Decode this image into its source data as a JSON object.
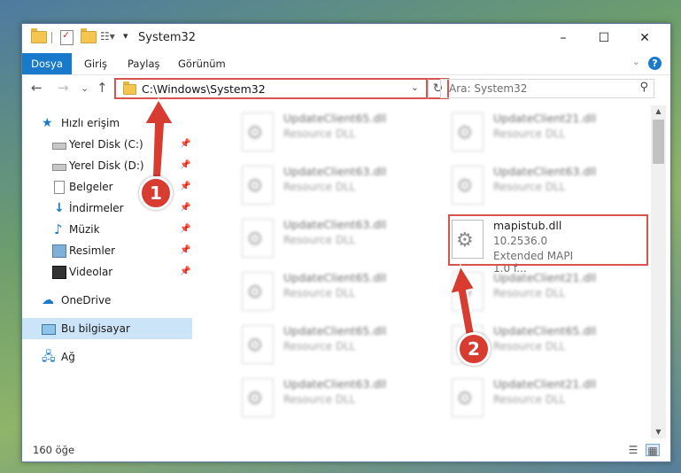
{
  "window": {
    "title": "System32",
    "controls": {
      "minimize": "–",
      "maximize": "☐",
      "close": "✕"
    }
  },
  "ribbon": {
    "tabs": [
      "Dosya",
      "Giriş",
      "Paylaş",
      "Görünüm"
    ],
    "help": "?",
    "collapse": "⌄"
  },
  "nav": {
    "back": "←",
    "forward": "→",
    "recent": "⌄",
    "up": "↑",
    "address": "C:\\Windows\\System32",
    "address_chevron": "⌄",
    "refresh": "↻",
    "search_placeholder": "Ara: System32",
    "search_icon": "⚲"
  },
  "sidebar": {
    "items": [
      {
        "label": "Hızlı erişim",
        "icon": "star-icon",
        "pinned": false
      },
      {
        "label": "Yerel Disk (C:)",
        "icon": "drive-icon",
        "pinned": true
      },
      {
        "label": "Yerel Disk (D:)",
        "icon": "drive-icon",
        "pinned": true
      },
      {
        "label": "Belgeler",
        "icon": "document-icon",
        "pinned": true
      },
      {
        "label": "İndirmeler",
        "icon": "download-icon",
        "pinned": true
      },
      {
        "label": "Müzik",
        "icon": "music-icon",
        "pinned": true
      },
      {
        "label": "Resimler",
        "icon": "pictures-icon",
        "pinned": true
      },
      {
        "label": "Videolar",
        "icon": "video-icon",
        "pinned": true
      },
      {
        "label": "OneDrive",
        "icon": "cloud-icon",
        "pinned": false
      },
      {
        "label": "Bu bilgisayar",
        "icon": "computer-icon",
        "pinned": false,
        "selected": true
      },
      {
        "label": "Ağ",
        "icon": "network-icon",
        "pinned": false
      }
    ],
    "pin_glyph": "📌"
  },
  "files": [
    {
      "name": "UpdateClient65.dll",
      "line2": "Resource DLL",
      "line3": "",
      "blurred": true
    },
    {
      "name": "UpdateClient21.dll",
      "line2": "Resource DLL",
      "line3": "",
      "blurred": true
    },
    {
      "name": "UpdateClient63.dll",
      "line2": "Resource DLL",
      "line3": "",
      "blurred": true
    },
    {
      "name": "UpdateClient63.dll",
      "line2": "Resource DLL",
      "line3": "",
      "blurred": true
    },
    {
      "name": "UpdateClient63.dll",
      "line2": "Resource DLL",
      "line3": "",
      "blurred": true
    },
    {
      "name": "mapistub.dll",
      "line2": "10.2536.0",
      "line3": "Extended MAPI 1.0 f...",
      "blurred": false,
      "highlighted": true
    },
    {
      "name": "UpdateClient65.dll",
      "line2": "Resource DLL",
      "line3": "",
      "blurred": true
    },
    {
      "name": "UpdateClient21.dll",
      "line2": "Resource DLL",
      "line3": "",
      "blurred": true
    },
    {
      "name": "UpdateClient65.dll",
      "line2": "Resource DLL",
      "line3": "",
      "blurred": true
    },
    {
      "name": "UpdateClient65.dll",
      "line2": "Resource DLL",
      "line3": "",
      "blurred": true
    },
    {
      "name": "UpdateClient63.dll",
      "line2": "Resource DLL",
      "line3": "",
      "blurred": true
    },
    {
      "name": "UpdateClient21.dll",
      "line2": "Resource DLL",
      "line3": "",
      "blurred": true
    }
  ],
  "status": {
    "item_count": "160 öğe"
  },
  "annotations": {
    "step1": "1",
    "step2": "2",
    "accent_color": "#d9534f"
  }
}
